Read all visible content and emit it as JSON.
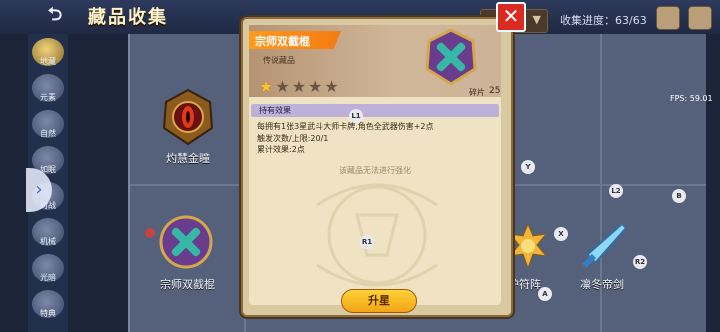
{
  "header": {
    "back_symbol": "⮌",
    "title": "藏品收集",
    "progress_label": "收集进度：63/63"
  },
  "sidebar": {
    "items": [
      {
        "label": "地藏"
      },
      {
        "label": "元素"
      },
      {
        "label": "自然"
      },
      {
        "label": "如眠"
      },
      {
        "label": "对战"
      },
      {
        "label": "机械"
      },
      {
        "label": "光暗"
      },
      {
        "label": "特典"
      }
    ]
  },
  "grid": {
    "cards": [
      {
        "label": "灼慧金瞳",
        "icon": "red-eye-medal-icon"
      },
      {
        "label": "宗师双截棍",
        "icon": "crossed-nunchaku-icon"
      },
      {
        "label": "护符阵",
        "icon": "sun-amulet-icon"
      },
      {
        "label": "凛冬帝剑",
        "icon": "frost-sword-icon"
      }
    ],
    "fps": "FPS: 59.01"
  },
  "controller_hints": [
    "L1",
    "R1",
    "Y",
    "X",
    "A",
    "B",
    "L2",
    "R2"
  ],
  "dialog": {
    "item_name": "宗师双截棍",
    "rarity": "传说藏品",
    "stars_total": 5,
    "stars_filled": 1,
    "fragment_label": "碎片",
    "fragment_value": "25",
    "effect_title": "持有效果",
    "effect_lines": [
      "每拥有1张3星武斗大师卡牌,角色全武器伤害+2点",
      "触发次数/上限:20/1",
      "累计效果:2点"
    ],
    "note": "该藏品无法进行强化",
    "upgrade_button": "升星",
    "close_symbol": "✕"
  },
  "colors": {
    "ribbon": "#f37b12",
    "star_filled": "#f7c531",
    "upgrade_button": "#f2a316",
    "close_button": "#d92b22",
    "effect_bar": "#bdb0d9"
  }
}
